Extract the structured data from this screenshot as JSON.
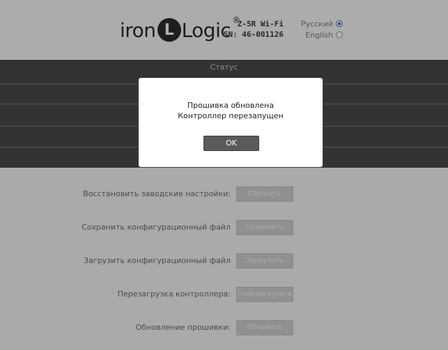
{
  "header": {
    "logo": {
      "prefix": "iron",
      "badge": "L",
      "suffix": "Logic",
      "reg": "®"
    },
    "device": {
      "model": "Z-5R Wi-Fi",
      "serial": "SN: 46-001126"
    },
    "languages": [
      {
        "label": "Русский",
        "selected": true
      },
      {
        "label": "English",
        "selected": false
      }
    ]
  },
  "status": {
    "title": "Статус"
  },
  "settings": [
    {
      "label": "Восстановить заводские настройки:",
      "button": "Сбросить"
    },
    {
      "label": "Сохранить конфигурационный файл",
      "button": "Сохранить"
    },
    {
      "label": "Загрузить конфигурационный файл",
      "button": "Загрузить"
    },
    {
      "label": "Перезагрузка контроллера:",
      "button": "Перезагрузить"
    },
    {
      "label": "Обновление прошивки:",
      "button": "Обновить"
    }
  ],
  "modal": {
    "line1": "Прошивка обновлена",
    "line2": "Контроллер перезапущен",
    "ok_label": "OK"
  },
  "colors": {
    "radio_selected": "#2f5fb3",
    "status_panel": "#4a4a4a"
  }
}
